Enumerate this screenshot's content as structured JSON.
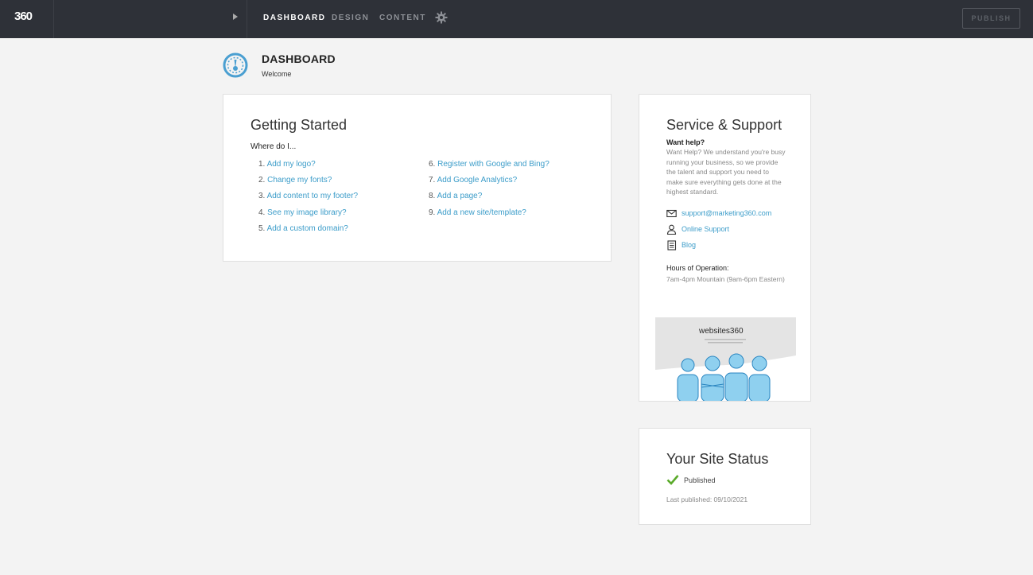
{
  "topbar": {
    "logo": "360",
    "nav": [
      "DASHBOARD",
      "DESIGN",
      "CONTENT"
    ],
    "publish_label": "PUBLISH"
  },
  "header": {
    "title": "DASHBOARD",
    "subtitle": "Welcome"
  },
  "getting_started": {
    "title": "Getting Started",
    "intro": "Where do I...",
    "items": [
      {
        "num": "1.",
        "label": "Add my logo?"
      },
      {
        "num": "2.",
        "label": "Change my fonts?"
      },
      {
        "num": "3.",
        "label": "Add content to my footer?"
      },
      {
        "num": "4.",
        "label": "See my image library?"
      },
      {
        "num": "5.",
        "label": "Add a custom domain?"
      },
      {
        "num": "6.",
        "label": "Register with Google and Bing?"
      },
      {
        "num": "7.",
        "label": "Add Google Analytics?"
      },
      {
        "num": "8.",
        "label": "Add a page?"
      },
      {
        "num": "9.",
        "label": "Add a new site/template?"
      }
    ]
  },
  "support": {
    "title": "Service & Support",
    "help_heading": "Want help?",
    "help_text": "Want Help? We understand you're busy running your business, so we provide the talent and support you need to make sure everything gets done at the highest standard.",
    "email": "support@marketing360.com",
    "online_support": "Online Support",
    "blog": "Blog",
    "hours_heading": "Hours of Operation:",
    "hours_text": "7am-4pm Mountain (9am-6pm Eastern)",
    "promo_logo": "websites360"
  },
  "site_status": {
    "title": "Your Site Status",
    "status": "Published",
    "last_published": "Last published: 09/10/2021"
  },
  "colors": {
    "topbar": "#2e3138",
    "link": "#3b9cc9",
    "accent_icon": "#4a9fd1",
    "published_check": "#5aaa2a"
  }
}
